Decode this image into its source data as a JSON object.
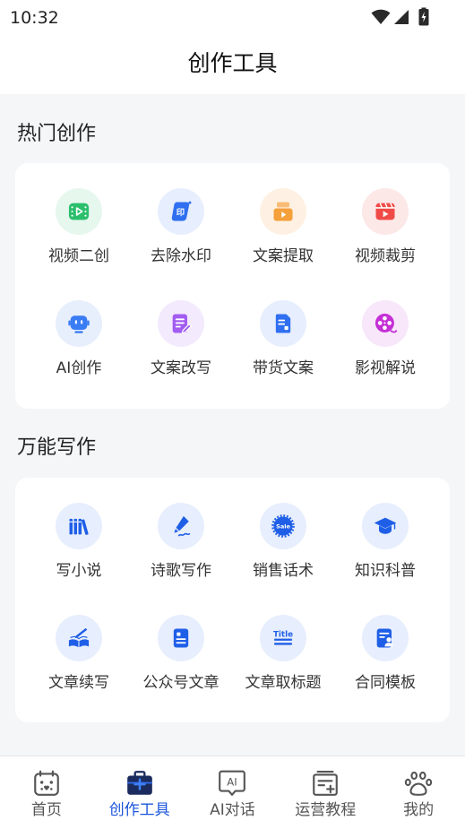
{
  "status_bar": {
    "time": "10:32",
    "icons": [
      "wifi-icon",
      "signal-icon",
      "battery-charging-icon"
    ]
  },
  "header": {
    "title": "创作工具"
  },
  "sections": [
    {
      "title": "热门创作",
      "items": [
        {
          "label": "视频二创",
          "icon": "video-remix-icon",
          "color": "#2bbf6c",
          "bg": "#e6f7ee"
        },
        {
          "label": "去除水印",
          "icon": "watermark-remove-icon",
          "icon_text": "印",
          "color": "#2f6ff0",
          "bg": "#e7eefd"
        },
        {
          "label": "文案提取",
          "icon": "copy-extract-icon",
          "color": "#f5a03a",
          "bg": "#fef1e3"
        },
        {
          "label": "视频裁剪",
          "icon": "video-clip-icon",
          "color": "#f04b47",
          "bg": "#fde8e8"
        },
        {
          "label": "AI创作",
          "icon": "robot-icon",
          "color": "#3a7cf4",
          "bg": "#e7effd"
        },
        {
          "label": "文案改写",
          "icon": "rewrite-icon",
          "color": "#a25cf0",
          "bg": "#f3eafd"
        },
        {
          "label": "带货文案",
          "icon": "sales-doc-icon",
          "color": "#2f6ff0",
          "bg": "#e7eefd"
        },
        {
          "label": "影视解说",
          "icon": "film-reel-icon",
          "color": "#c52fd6",
          "bg": "#f8e7fb"
        }
      ]
    },
    {
      "title": "万能写作",
      "items": [
        {
          "label": "写小说",
          "icon": "books-icon",
          "color": "#1f5fe8",
          "bg": "#e7eefd"
        },
        {
          "label": "诗歌写作",
          "icon": "quill-icon",
          "color": "#1f5fe8",
          "bg": "#e7eefd"
        },
        {
          "label": "销售话术",
          "icon": "sale-badge-icon",
          "icon_text": "Sale",
          "color": "#1f5fe8",
          "bg": "#e7eefd"
        },
        {
          "label": "知识科普",
          "icon": "graduation-cap-icon",
          "color": "#1f5fe8",
          "bg": "#e7eefd"
        },
        {
          "label": "文章续写",
          "icon": "book-pen-icon",
          "color": "#1f5fe8",
          "bg": "#e7eefd"
        },
        {
          "label": "公众号文章",
          "icon": "article-icon",
          "color": "#1f5fe8",
          "bg": "#e7eefd"
        },
        {
          "label": "文章取标题",
          "icon": "title-icon",
          "icon_text": "Title",
          "color": "#1f5fe8",
          "bg": "#e7eefd"
        },
        {
          "label": "合同模板",
          "icon": "contract-icon",
          "color": "#1f5fe8",
          "bg": "#e7eefd"
        }
      ]
    }
  ],
  "tab_bar": {
    "active_index": 1,
    "active_color": "#1a56db",
    "inactive_color": "#555555",
    "items": [
      {
        "label": "首页",
        "icon": "home-icon"
      },
      {
        "label": "创作工具",
        "icon": "toolbox-icon"
      },
      {
        "label": "AI对话",
        "icon": "ai-chat-icon",
        "icon_text": "AI"
      },
      {
        "label": "运营教程",
        "icon": "tutorial-icon"
      },
      {
        "label": "我的",
        "icon": "paw-icon"
      }
    ]
  },
  "colors": {
    "page_background": "#f5f6f8",
    "card_background": "#ffffff",
    "accent": "#1a56db"
  }
}
